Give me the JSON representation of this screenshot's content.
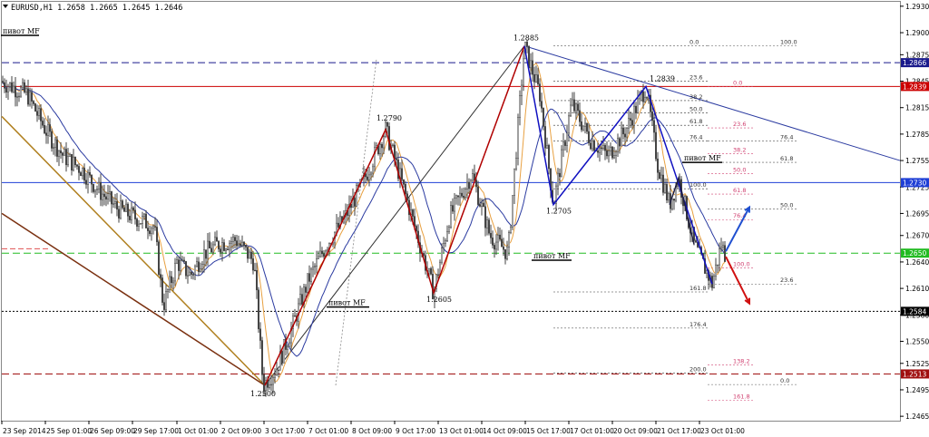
{
  "header": {
    "symbol_label": "EURUSD,H1  1.2658  1.2665  1.2645  1.2646",
    "menu_icon": "triangle-down-icon"
  },
  "chart_data": {
    "type": "candlestick",
    "symbol": "EURUSD",
    "timeframe": "H1",
    "ohlc_header": {
      "open": 1.2658,
      "high": 1.2665,
      "low": 1.2645,
      "close": 1.2646
    },
    "ylim": [
      1.246,
      1.2935
    ],
    "y_ticks": [
      1.293,
      1.29,
      1.2875,
      1.2845,
      1.2815,
      1.2785,
      1.2755,
      1.2725,
      1.2695,
      1.267,
      1.264,
      1.261,
      1.258,
      1.255,
      1.2525,
      1.2495,
      1.2465
    ],
    "x_tick_labels": [
      "23 Sep 2014",
      "25 Sep 01:00",
      "26 Sep 09:00",
      "29 Sep 17:00",
      "1 Oct 01:00",
      "2 Oct 09:00",
      "3 Oct 17:00",
      "7 Oct 01:00",
      "8 Oct 09:00",
      "9 Oct 17:00",
      "13 Oct 01:00",
      "14 Oct 09:00",
      "15 Oct 17:00",
      "17 Oct 01:00",
      "20 Oct 09:00",
      "21 Oct 17:00",
      "23 Oct 01:00"
    ],
    "price_path": [
      [
        0,
        1.2845
      ],
      [
        15,
        1.2838
      ],
      [
        30,
        1.283
      ],
      [
        50,
        1.279
      ],
      [
        70,
        1.276
      ],
      [
        90,
        1.2745
      ],
      [
        110,
        1.272
      ],
      [
        130,
        1.27
      ],
      [
        150,
        1.269
      ],
      [
        170,
        1.268
      ],
      [
        180,
        1.259
      ],
      [
        195,
        1.264
      ],
      [
        210,
        1.2625
      ],
      [
        225,
        1.265
      ],
      [
        240,
        1.266
      ],
      [
        260,
        1.2665
      ],
      [
        280,
        1.264
      ],
      [
        290,
        1.25
      ],
      [
        305,
        1.252
      ],
      [
        320,
        1.256
      ],
      [
        340,
        1.262
      ],
      [
        360,
        1.266
      ],
      [
        380,
        1.269
      ],
      [
        400,
        1.273
      ],
      [
        425,
        1.279
      ],
      [
        440,
        1.274
      ],
      [
        460,
        1.267
      ],
      [
        478,
        1.2605
      ],
      [
        495,
        1.269
      ],
      [
        520,
        1.274
      ],
      [
        540,
        1.267
      ],
      [
        560,
        1.265
      ],
      [
        578,
        1.2885
      ],
      [
        595,
        1.283
      ],
      [
        610,
        1.2705
      ],
      [
        630,
        1.282
      ],
      [
        650,
        1.278
      ],
      [
        670,
        1.276
      ],
      [
        690,
        1.279
      ],
      [
        712,
        1.2839
      ],
      [
        725,
        1.275
      ],
      [
        738,
        1.2705
      ],
      [
        748,
        1.2735
      ],
      [
        765,
        1.266
      ],
      [
        785,
        1.2615
      ],
      [
        795,
        1.266
      ],
      [
        800,
        1.2646
      ]
    ],
    "horizontal_levels": [
      {
        "label": "1.2866",
        "price": 1.2866,
        "color": "#1a1a8c",
        "style": "dashed"
      },
      {
        "label": "1.2839",
        "price": 1.2839,
        "color": "#cc0000",
        "style": "solid"
      },
      {
        "label": "1.2730",
        "price": 1.273,
        "color": "#1f3fd6",
        "style": "solid"
      },
      {
        "label": "1.2650",
        "price": 1.265,
        "color": "#22bb22",
        "style": "dashed"
      },
      {
        "label": "1.2584",
        "price": 1.2584,
        "color": "#000000",
        "style": "dotted"
      },
      {
        "label": "1.2513",
        "price": 1.2513,
        "color": "#a01010",
        "style": "dashed"
      }
    ],
    "swing_labels": [
      {
        "text": "1.2885",
        "x": 578,
        "price": 1.2885
      },
      {
        "text": "1.2839",
        "x": 712,
        "price": 1.2839
      },
      {
        "text": "1.2790",
        "x": 425,
        "price": 1.279
      },
      {
        "text": "1.2705",
        "x": 610,
        "price": 1.2705
      },
      {
        "text": "1.2605",
        "x": 478,
        "price": 1.2605
      },
      {
        "text": "1.2500",
        "x": 290,
        "price": 1.25
      }
    ],
    "pivot_labels": [
      "пивот MF",
      "пивот MF",
      "пивот MF",
      "пивот MF"
    ],
    "fib_levels_main": [
      "0.0",
      "23.6",
      "38.2",
      "50.0",
      "61.8",
      "76.4",
      "100.0",
      "161.8",
      "176.4",
      "200.0"
    ],
    "fib_levels_alt": [
      "100.0",
      "76.4",
      "61.8",
      "50.0",
      "23.6",
      "0.0"
    ],
    "fib_levels_pink": [
      "0.0",
      "23.6",
      "38.2",
      "50.0",
      "61.8",
      "76.4",
      "100.0",
      "138.2",
      "161.8"
    ],
    "colors": {
      "background": "#ffffff",
      "candle": "#404040",
      "ma_fast": "#e8a040",
      "ma_slow": "#2a3aa0",
      "zigzag_red": "#b00000",
      "zigzag_blue": "#1010c0",
      "trend_black": "#303030",
      "trend_brown": "#7a3010",
      "trend_gold": "#b08020",
      "arrow_up": "#2050d0",
      "arrow_down": "#d01010"
    }
  }
}
